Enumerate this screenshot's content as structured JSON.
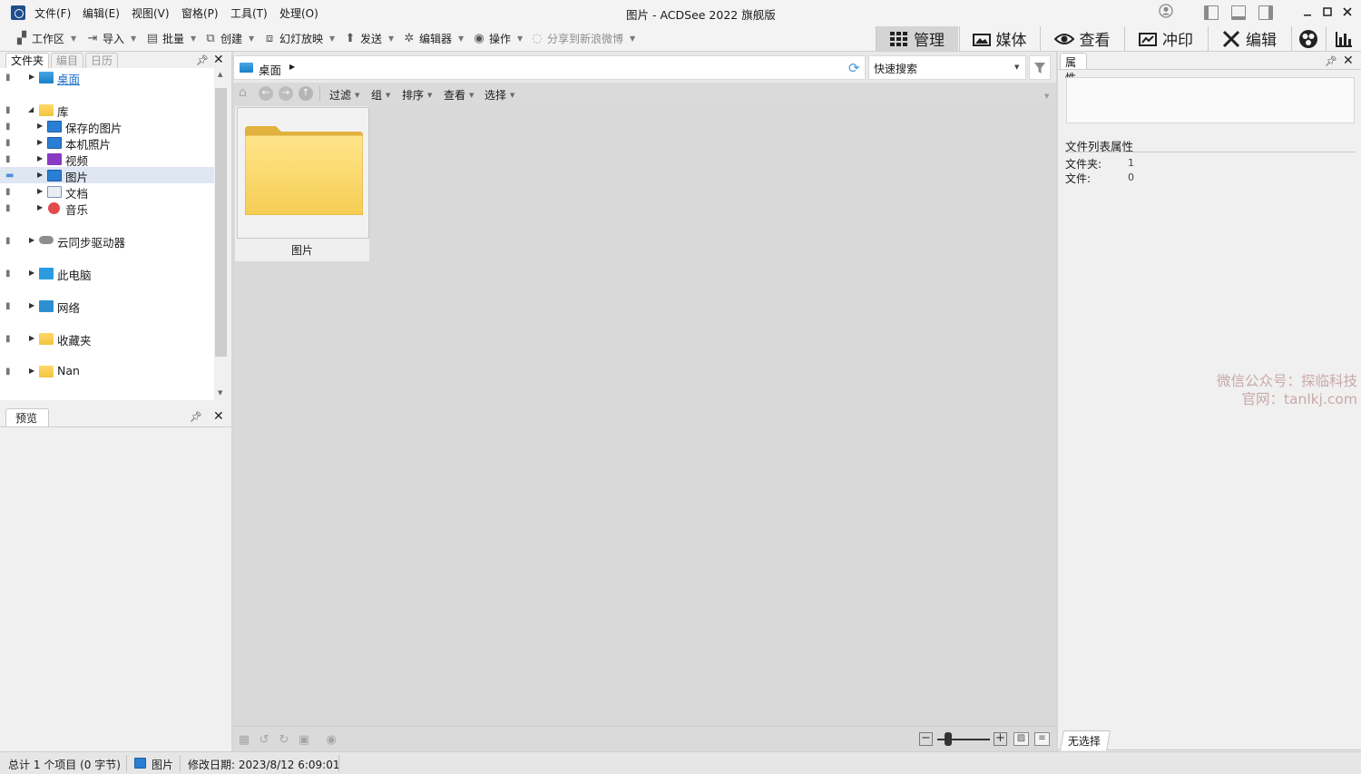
{
  "window": {
    "title": "图片 - ACDSee 2022 旗舰版",
    "menus": [
      "文件(F)",
      "编辑(E)",
      "视图(V)",
      "窗格(P)",
      "工具(T)",
      "处理(O)"
    ]
  },
  "toolbar": {
    "workspace": "工作区",
    "import": "导入",
    "batch": "批量",
    "create": "创建",
    "slideshow": "幻灯放映",
    "send": "发送",
    "editor": "编辑器",
    "actions": "操作",
    "share_weibo": "分享到新浪微博"
  },
  "modes": {
    "manage": "管理",
    "media": "媒体",
    "view": "查看",
    "develop": "冲印",
    "edit": "编辑"
  },
  "left_panel": {
    "tabs": [
      "文件夹",
      "编目",
      "日历"
    ],
    "tree": {
      "desktop": "桌面",
      "library": "库",
      "saved_pictures": "保存的图片",
      "camera_roll": "本机照片",
      "videos": "视频",
      "pictures": "图片",
      "documents": "文档",
      "music": "音乐",
      "cloud_drives": "云同步驱动器",
      "this_pc": "此电脑",
      "network": "网络",
      "favorites": "收藏夹",
      "nan": "Nan"
    },
    "preview_tab": "预览"
  },
  "browser": {
    "address_path": "桌面",
    "quick_search_placeholder": "快速搜索",
    "toolbar": {
      "filter": "过滤",
      "group": "组",
      "sort": "排序",
      "view": "查看",
      "select": "选择"
    },
    "items": [
      {
        "name": "图片",
        "type": "folder"
      }
    ]
  },
  "properties": {
    "title": "属性",
    "section": "文件列表属性",
    "rows": [
      {
        "key": "文件夹:",
        "value": "1"
      },
      {
        "key": "文件:",
        "value": "0"
      }
    ],
    "tab_no_selection": "无选择"
  },
  "watermark": {
    "line1": "微信公众号：探临科技",
    "line2": "官网：tanlkj.com"
  },
  "statusbar": {
    "total": "总计 1 个项目 (0 字节)",
    "current": "图片",
    "modified": "修改日期: 2023/8/12 6:09:01"
  },
  "colors": {
    "accent_blue": "#1f6fc5",
    "folder_yellow": "#f7d260",
    "selection": "#dfe7f3"
  }
}
